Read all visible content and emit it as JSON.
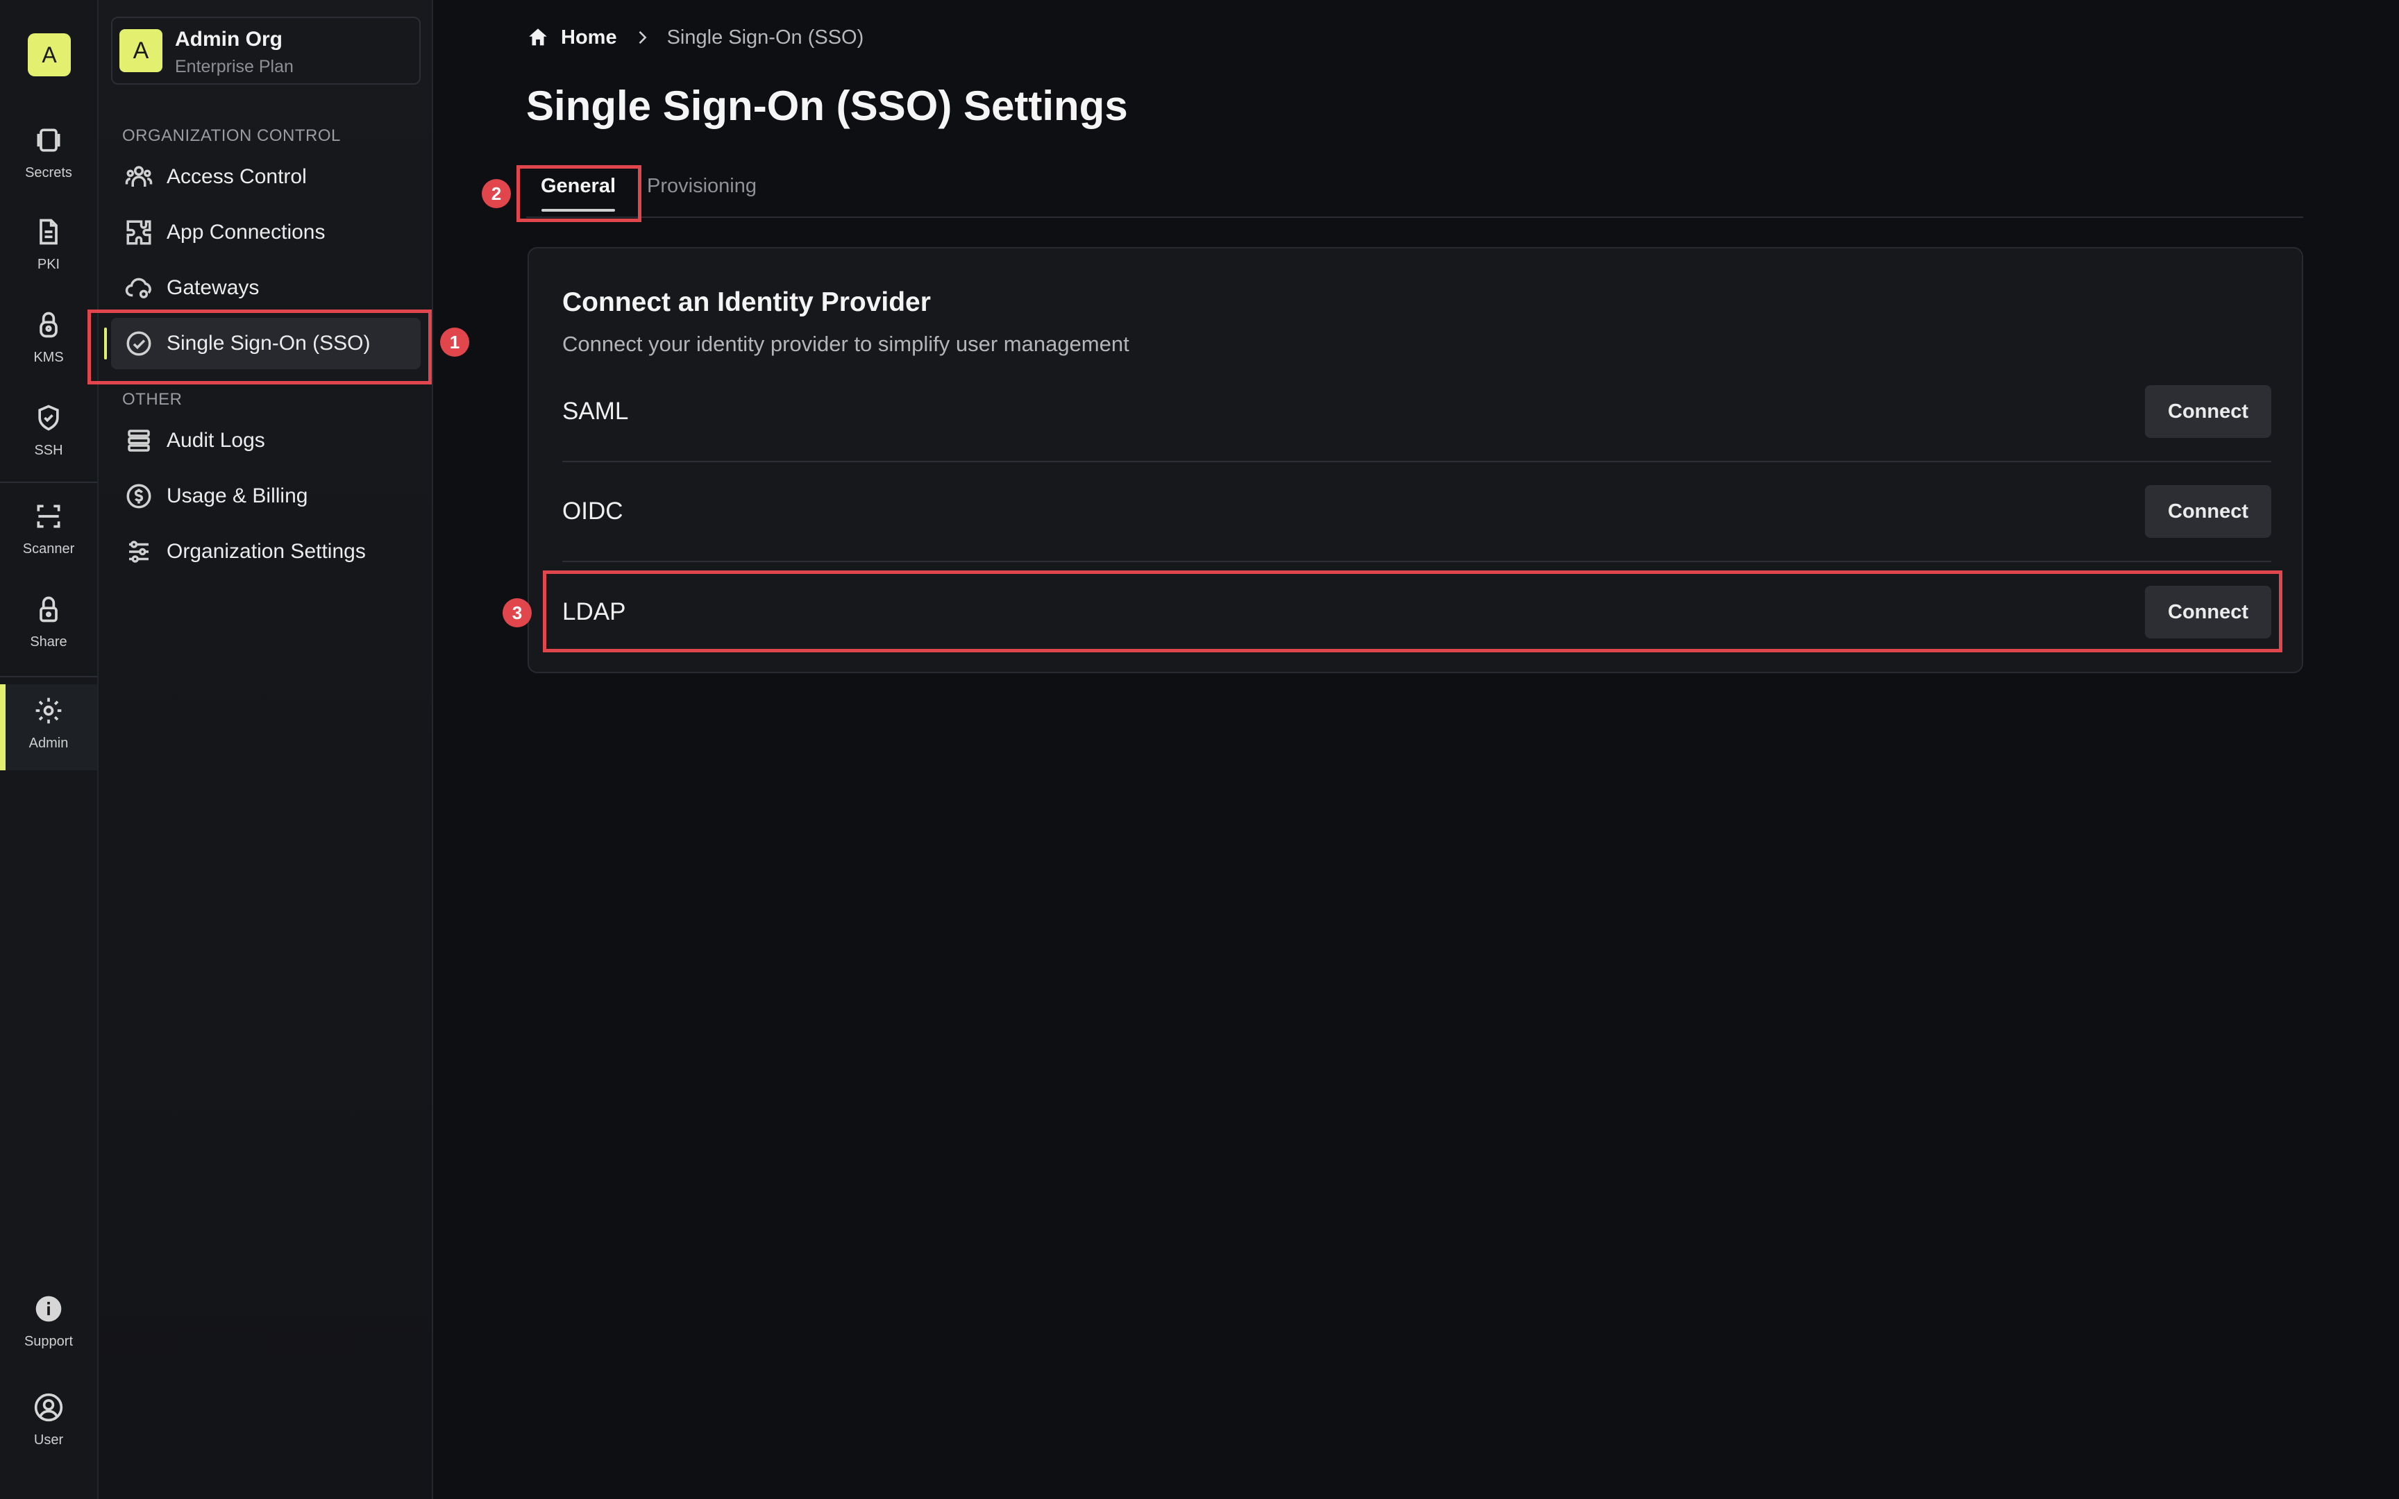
{
  "rail": {
    "logo": "A",
    "items": [
      {
        "label": "Secrets",
        "icon": "secrets-icon"
      },
      {
        "label": "PKI",
        "icon": "document-icon"
      },
      {
        "label": "KMS",
        "icon": "lock-key-icon"
      },
      {
        "label": "SSH",
        "icon": "shield-check-icon"
      },
      {
        "label": "Scanner",
        "icon": "scan-icon"
      },
      {
        "label": "Share",
        "icon": "lock-icon"
      },
      {
        "label": "Admin",
        "icon": "gear-icon"
      },
      {
        "label": "Support",
        "icon": "info-icon"
      },
      {
        "label": "User",
        "icon": "user-circle-icon"
      }
    ],
    "active": "Admin"
  },
  "org": {
    "avatar": "A",
    "name": "Admin Org",
    "plan": "Enterprise Plan"
  },
  "sidebar": {
    "section_org": "ORGANIZATION CONTROL",
    "section_other": "OTHER",
    "items": [
      {
        "label": "Access Control",
        "icon": "users-icon"
      },
      {
        "label": "App Connections",
        "icon": "puzzle-icon"
      },
      {
        "label": "Gateways",
        "icon": "cloud-gear-icon"
      },
      {
        "label": "Single Sign-On (SSO)",
        "icon": "check-circle-icon"
      },
      {
        "label": "Audit Logs",
        "icon": "list-icon"
      },
      {
        "label": "Usage & Billing",
        "icon": "dollar-circle-icon"
      },
      {
        "label": "Organization Settings",
        "icon": "sliders-icon"
      }
    ],
    "active": "Single Sign-On (SSO)"
  },
  "breadcrumb": {
    "home": "Home",
    "current": "Single Sign-On (SSO)"
  },
  "page": {
    "title": "Single Sign-On (SSO) Settings"
  },
  "tabs": [
    {
      "label": "General",
      "active": true
    },
    {
      "label": "Provisioning",
      "active": false
    }
  ],
  "card": {
    "title": "Connect an Identity Provider",
    "subtitle": "Connect your identity provider to simplify user management",
    "providers": [
      {
        "name": "SAML",
        "action": "Connect"
      },
      {
        "name": "OIDC",
        "action": "Connect"
      },
      {
        "name": "LDAP",
        "action": "Connect"
      }
    ]
  },
  "annotations": [
    "1",
    "2",
    "3"
  ],
  "colors": {
    "accent": "#e2ef6f",
    "annotation": "#e0464c",
    "background": "#0e0f12"
  }
}
